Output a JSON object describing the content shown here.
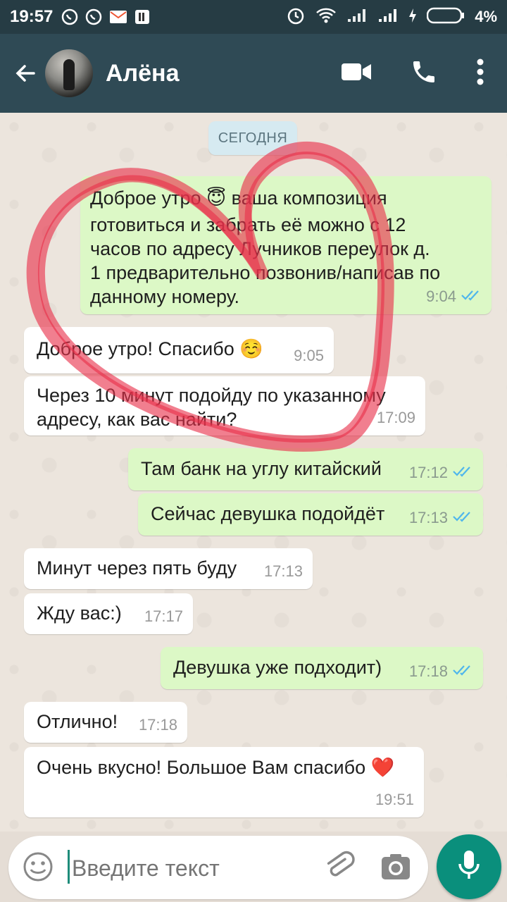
{
  "status_bar": {
    "time": "19:57",
    "battery_percent": "4%",
    "icons": [
      "whatsapp-icon",
      "whatsapp-icon",
      "mail-icon",
      "app-icon",
      "alarm-icon",
      "wifi-icon",
      "signal-icon",
      "signal-icon",
      "charging-icon",
      "battery-icon"
    ]
  },
  "header": {
    "contact_name": "Алёна",
    "icons": [
      "back-arrow-icon",
      "video-call-icon",
      "phone-icon",
      "more-icon"
    ]
  },
  "chat": {
    "date_chip": "СЕГОДНЯ",
    "messages": [
      {
        "direction": "out",
        "lines": [
          "Доброе утро 😇 ваша композиция",
          "готовиться и забрать её можно с 12",
          "часов по адресу Лучников переулок д.",
          "1 предварительно позвонив/написав по",
          "данному номеру."
        ],
        "time": "9:04",
        "status": "read"
      },
      {
        "direction": "in",
        "text": "Доброе утро! Спасибо ☺️",
        "time": "9:05"
      },
      {
        "direction": "in",
        "lines": [
          "Через 10 минут подойду по указанному",
          "адресу, как вас найти?"
        ],
        "time": "17:09"
      },
      {
        "direction": "out",
        "text": "Там банк на углу китайский",
        "time": "17:12",
        "status": "read"
      },
      {
        "direction": "out",
        "text": "Сейчас девушка подойдёт",
        "time": "17:13",
        "status": "read"
      },
      {
        "direction": "in",
        "text": "Минут через пять буду",
        "time": "17:13"
      },
      {
        "direction": "in",
        "text": "Жду вас:)",
        "time": "17:17"
      },
      {
        "direction": "out",
        "text": "Девушка уже подходит)",
        "time": "17:18",
        "status": "read"
      },
      {
        "direction": "in",
        "text": "Отлично!",
        "time": "17:18"
      },
      {
        "direction": "in",
        "text": "Очень вкусно! Большое Вам спасибо ❤️",
        "time": "19:51"
      }
    ]
  },
  "input": {
    "placeholder": "Введите текст",
    "icons": [
      "emoji-icon",
      "attach-icon",
      "camera-icon",
      "mic-icon"
    ]
  },
  "colors": {
    "status_bar": "#263c44",
    "app_bar": "#2f4a55",
    "outgoing_bubble": "#dcf8c6",
    "incoming_bubble": "#ffffff",
    "read_tick": "#4fb6ec",
    "mic_button": "#0a8f7c",
    "heart_scribble": "#e8304a"
  }
}
